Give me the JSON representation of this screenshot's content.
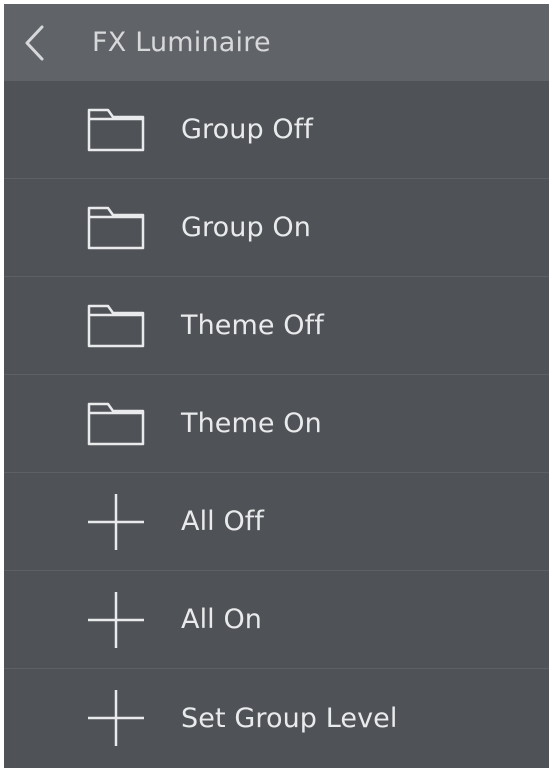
{
  "header": {
    "title": "FX Luminaire",
    "back_icon": "chevron-left-icon"
  },
  "items": [
    {
      "label": "Group Off",
      "icon": "folder-icon"
    },
    {
      "label": "Group On",
      "icon": "folder-icon"
    },
    {
      "label": "Theme Off",
      "icon": "folder-icon"
    },
    {
      "label": "Theme On",
      "icon": "folder-icon"
    },
    {
      "label": "All Off",
      "icon": "plus-icon"
    },
    {
      "label": "All On",
      "icon": "plus-icon"
    },
    {
      "label": "Set Group Level",
      "icon": "plus-icon"
    }
  ],
  "colors": {
    "header_bg": "#606368",
    "list_bg": "#4f5257",
    "text": "#e9eaeb",
    "divider": "#5d6065"
  }
}
